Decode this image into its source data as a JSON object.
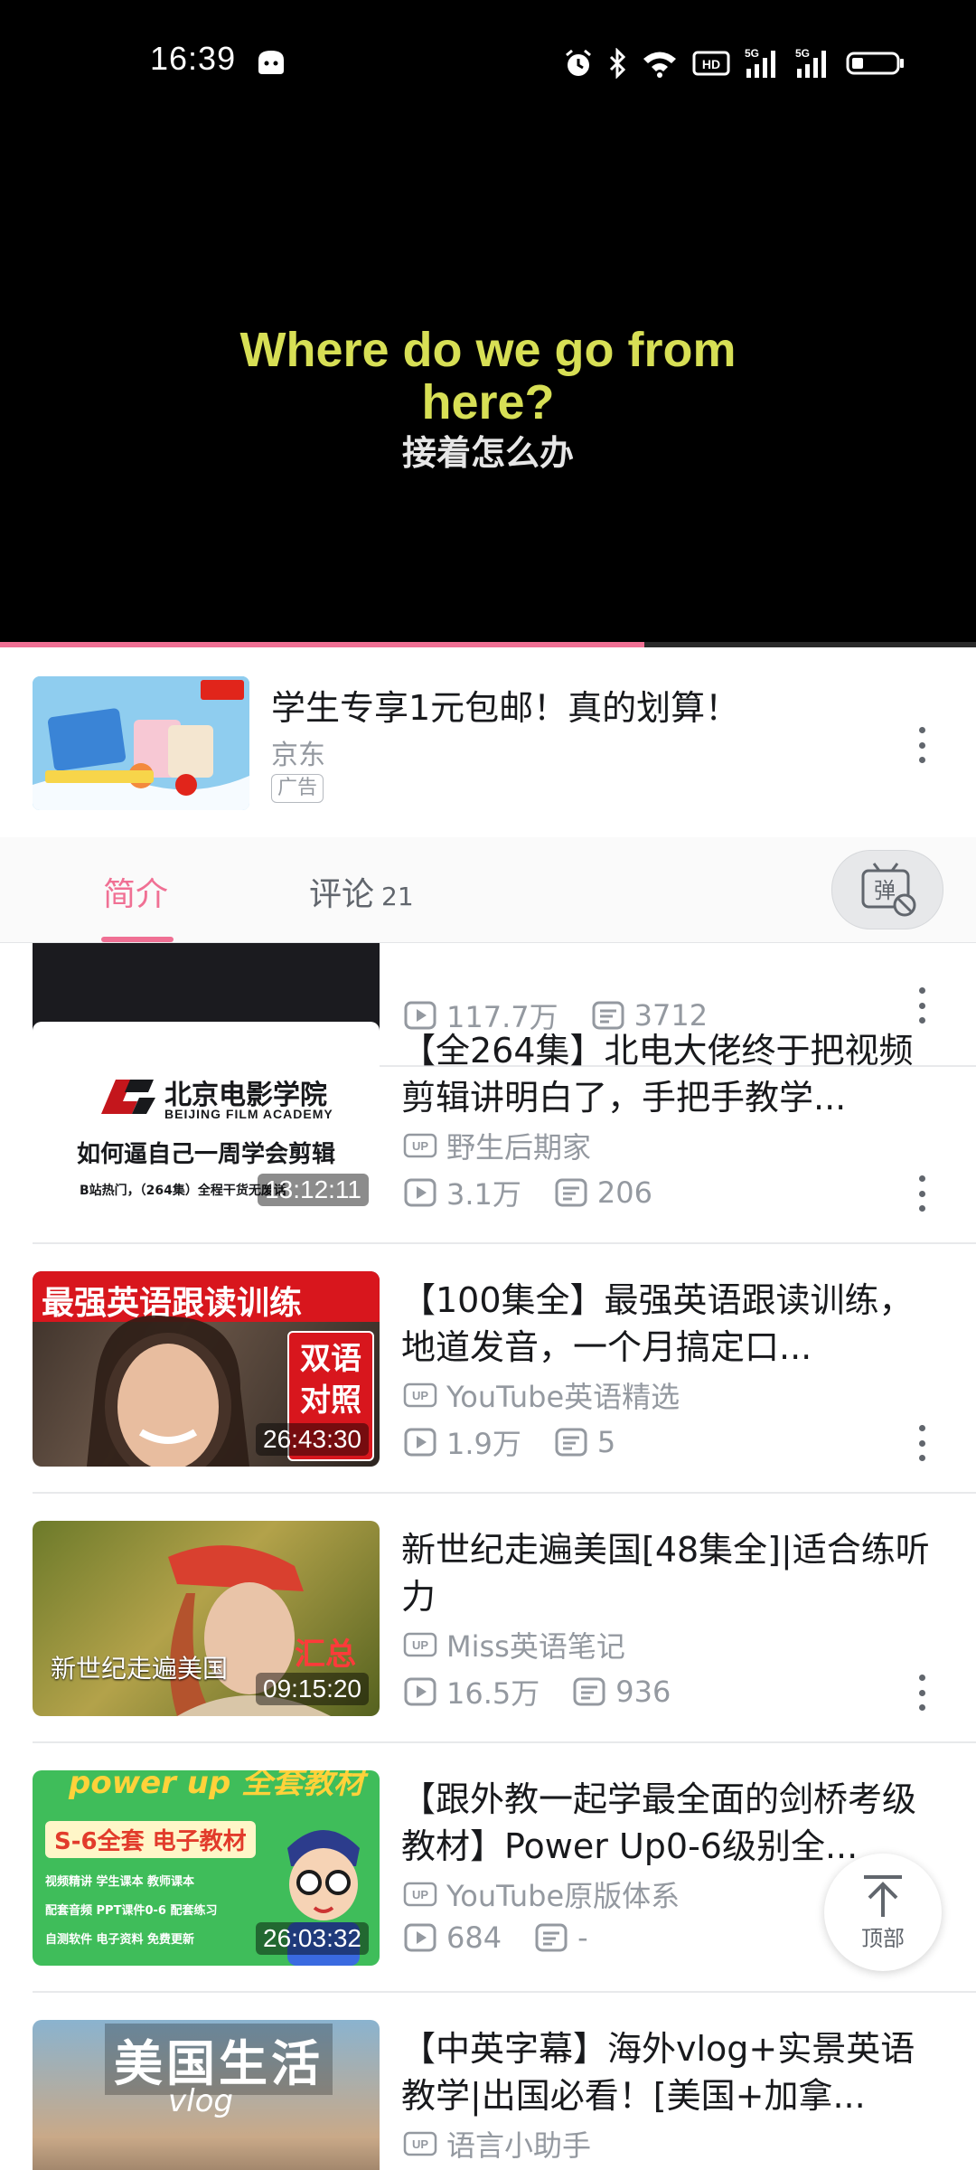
{
  "status_bar": {
    "time": "16:39",
    "icons": [
      "alarm-icon",
      "bluetooth-icon",
      "wifi-icon",
      "hd-voice-icon",
      "signal-5g-icon",
      "signal-5g-icon",
      "battery-icon"
    ],
    "hd_label": "HD",
    "net_label": "5G"
  },
  "video": {
    "subtitle_en": "Where do we go from here?",
    "subtitle_zh": "接着怎么办",
    "progress": 0.66
  },
  "ad": {
    "title": "学生专享1元包邮！真的划算！",
    "brand": "京东",
    "tag": "广告"
  },
  "tabs": {
    "intro": "简介",
    "comments": "评论",
    "comments_count": "21",
    "danmaku_label": "弹"
  },
  "partial_item": {
    "views": "117.7万",
    "comments": "3712"
  },
  "videos": [
    {
      "title": "【全264集】北电大佬终于把视频剪辑讲明白了，手把手教学...",
      "uploader": "野生后期家",
      "views": "3.1万",
      "comments": "206",
      "duration": "13:12:11",
      "thumb_text": {
        "school_zh": "北京电影学院",
        "school_en": "BEIJING FILM ACADEMY",
        "headline": "如何逼自己一周学会剪辑",
        "footnote": "B站热门，（264集）全程干货无废话"
      }
    },
    {
      "title": "【100集全】最强英语跟读训练，地道发音，一个月搞定口...",
      "uploader": "YouTube英语精选",
      "views": "1.9万",
      "comments": "5",
      "duration": "26:43:30",
      "thumb_text": {
        "banner": "最强英语跟读训练",
        "badge_line1": "双语",
        "badge_line2": "对照"
      }
    },
    {
      "title": "新世纪走遍美国[48集全]|适合练听力",
      "uploader": "Miss英语笔记",
      "views": "16.5万",
      "comments": "936",
      "duration": "09:15:20",
      "thumb_text": {
        "caption": "新世纪走遍美国",
        "badge": "汇总"
      }
    },
    {
      "title": "【跟外教一起学最全面的剑桥考级教材】Power Up0-6级别全...",
      "uploader": "YouTube原版体系",
      "views": "684",
      "comments": "-",
      "duration": "26:03:32",
      "thumb_text": {
        "banner": "power up 全套教材",
        "sub": "S-6全套 电子教材",
        "line1": "视频精讲  学生课本  教师课本",
        "line2": "配套音频  PPT课件0-6  配套练习",
        "line3": "自测软件  电子资料  免费更新"
      }
    },
    {
      "title": "【中英字幕】海外vlog+实景英语教学|出国必看！[美国+加拿...",
      "uploader": "语言小助手",
      "views": "",
      "comments": "",
      "duration": "",
      "thumb_text": {
        "headline": "美国生活",
        "sub": "vlog"
      }
    }
  ],
  "scroll_top": {
    "label": "顶部"
  },
  "colors": {
    "accent": "#f07094",
    "text": "#18191c",
    "secondary": "#9499a0"
  }
}
